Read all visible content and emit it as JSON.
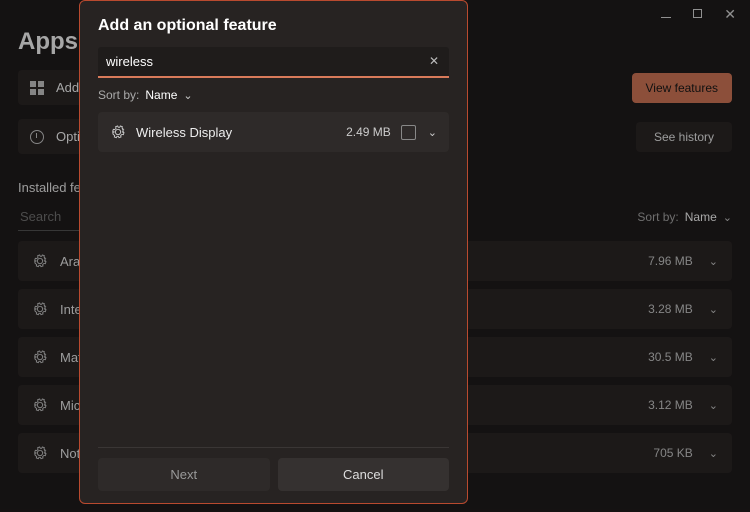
{
  "window": {
    "crumb_title": "Apps",
    "crumb_sep": "›"
  },
  "rows": {
    "add": "Add an optional feature",
    "opt": "Optional features"
  },
  "buttons": {
    "view_features": "View features",
    "see_history": "See history"
  },
  "installed": {
    "heading": "Installed features",
    "search_placeholder": "Search",
    "sort_label": "Sort by:",
    "sort_value": "Name"
  },
  "features": [
    {
      "name": "Arabic",
      "size": "7.96 MB"
    },
    {
      "name": "Internet",
      "size": "3.28 MB"
    },
    {
      "name": "Math",
      "size": "30.5 MB"
    },
    {
      "name": "Microsoft",
      "size": "3.12 MB"
    },
    {
      "name": "Notepad",
      "size": "705 KB"
    }
  ],
  "dialog": {
    "title": "Add an optional feature",
    "search_value": "wireless",
    "sort_label": "Sort by:",
    "sort_value": "Name",
    "result": {
      "name": "Wireless Display",
      "size": "2.49 MB"
    },
    "next": "Next",
    "cancel": "Cancel"
  }
}
